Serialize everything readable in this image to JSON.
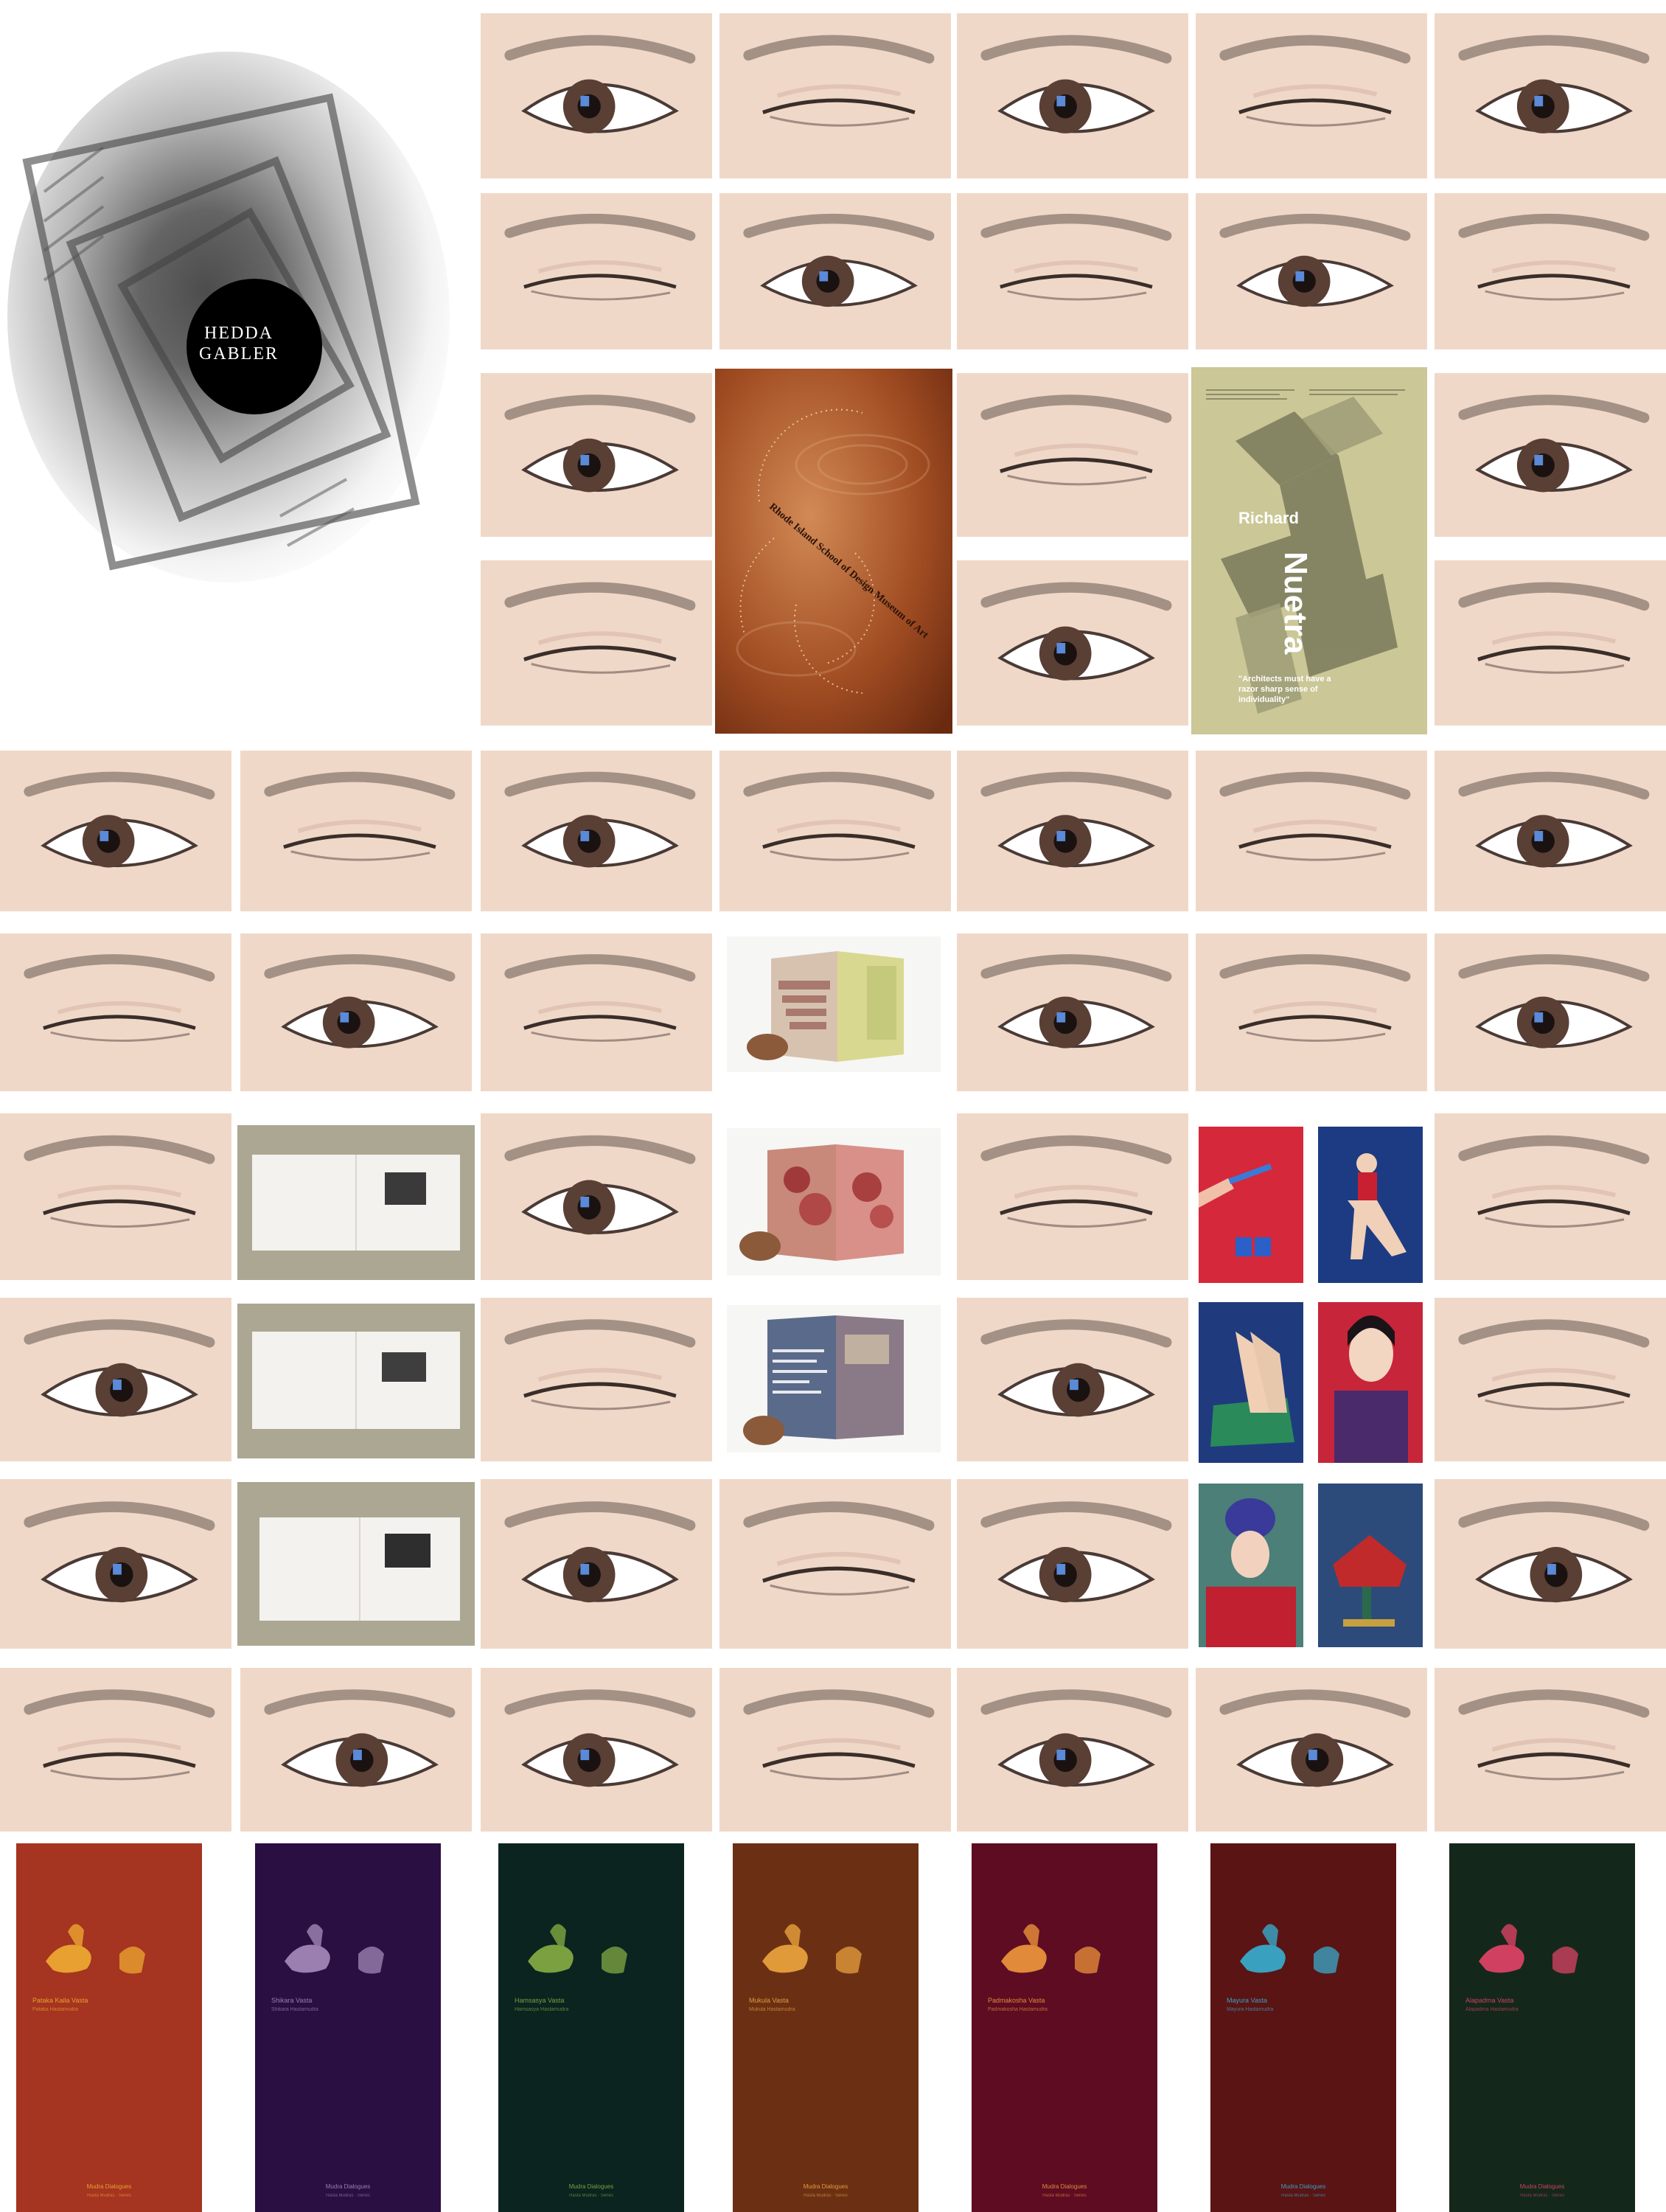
{
  "hedda_poster": {
    "line1": "HEDDA",
    "line2": "GABLER"
  },
  "risd_poster": {
    "title": "Rhode Island School of Design Museum of Art"
  },
  "neutra_poster": {
    "first_name": "Richard",
    "last_name": "Nuetra",
    "quote": "\"Architects must have a razor sharp sense of individuality\""
  },
  "mudra_posters": [
    {
      "name": "Pataka Kaila Vasta",
      "sub": "Pataka Hastamudra",
      "bg": "#a53420",
      "accent": "#e8a030",
      "footer": "Mudra Dialogues",
      "footer_sub": "Hasta Mudras · Series"
    },
    {
      "name": "Shikara Vasta",
      "sub": "Shikara Hastamudra",
      "bg": "#2a0f42",
      "accent": "#9a7fb0",
      "footer": "Mudra Dialogues",
      "footer_sub": "Hasta Mudras · Series"
    },
    {
      "name": "Hamsasya Vasta",
      "sub": "Hamsasya Hastamudra",
      "bg": "#0b2420",
      "accent": "#7ba040",
      "footer": "Mudra Dialogues",
      "footer_sub": "Hasta Mudras · Series"
    },
    {
      "name": "Mukula Vasta",
      "sub": "Mukula Hastamudra",
      "bg": "#6b3014",
      "accent": "#e09a3a",
      "footer": "Mudra Dialogues",
      "footer_sub": "Hasta Mudras · Series"
    },
    {
      "name": "Padmakosha Vasta",
      "sub": "Padmakosha Hastamudra",
      "bg": "#5e0c22",
      "accent": "#e08a3a",
      "footer": "Mudra Dialogues",
      "footer_sub": "Hasta Mudras · Series"
    },
    {
      "name": "Mayura Vasta",
      "sub": "Mayura Hastamudra",
      "bg": "#5a1414",
      "accent": "#3aa0c0",
      "footer": "Mudra Dialogues",
      "footer_sub": "Hasta Mudras · Series"
    },
    {
      "name": "Alapadma Vasta",
      "sub": "Alapadma Hastamudra",
      "bg": "#13281a",
      "accent": "#d04060",
      "footer": "Mudra Dialogues",
      "footer_sub": "Hasta Mudras · Series"
    }
  ],
  "eye_states": [
    "open",
    "closed"
  ],
  "colors": {
    "skin": "#f0d8c8",
    "iris": "#5a3f35",
    "sclera": "#ffffff",
    "brow": "#8a7a70"
  }
}
